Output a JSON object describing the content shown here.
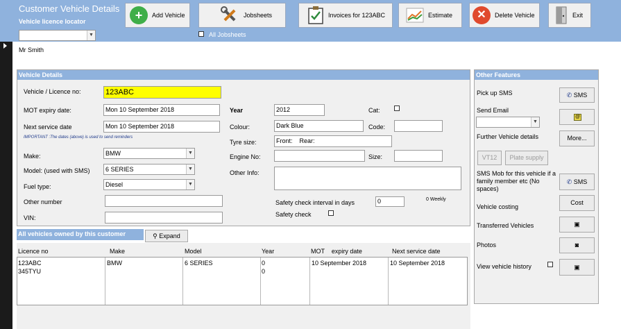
{
  "header": {
    "title": "Customer Vehicle Details",
    "locator_label": "Vehicle licence locator",
    "locator_value": "",
    "customer_name": "Mr Smith"
  },
  "toolbar": {
    "add_vehicle": "Add Vehicle",
    "jobsheets": "Jobsheets",
    "invoices": "Invoices for 123ABC",
    "estimate": "Estimate",
    "delete_vehicle": "Delete Vehicle",
    "exit": "Exit",
    "all_jobsheets": "All Jobsheets"
  },
  "vehicle_details": {
    "title": "Vehicle Details",
    "licence_label": "Vehicle  / Licence no:",
    "licence_value": "123ABC",
    "mot_label": "MOT   expiry date:",
    "mot_value": "Mon 10 September 2018",
    "next_service_label": "Next service date",
    "next_service_value": "Mon 10 September 2018",
    "important_note": "IMPORTANT :The dates (above) is used to send reminders",
    "make_label": "Make:",
    "make_value": "BMW",
    "model_label": "Model: (used with SMS)",
    "model_value": "6 SERIES",
    "fuel_label": "Fuel type:",
    "fuel_value": "Diesel",
    "other_number_label": "Other number",
    "other_number_value": "",
    "vin_label": "VIN:",
    "vin_value": "",
    "year_label": "Year",
    "year_value": "2012",
    "cat_label": "Cat:",
    "colour_label": "Colour:",
    "colour_value": "Dark Blue",
    "code_label": "Code:",
    "code_value": "",
    "tyre_label": "Tyre size:",
    "tyre_value": "Front:    Rear:",
    "engine_label": "Engine No:",
    "engine_value": "",
    "size_label": "Size:",
    "size_value": "",
    "other_info_label": "Other Info:",
    "other_info_value": "",
    "safety_interval_label": "Safety check interval in days",
    "safety_interval_value": "0",
    "weekly_label": "0  Weekly",
    "safety_check_label": "Safety check"
  },
  "owned": {
    "title": "All vehicles owned by this customer",
    "expand": "Expand",
    "columns": [
      "Licence no",
      "Make",
      "Model",
      "Year",
      "MOT    expiry date",
      "Next service date"
    ],
    "rows": [
      {
        "licence": "123ABC",
        "make": "BMW",
        "model": "6 SERIES",
        "year": "0",
        "mot": "10 September 2018",
        "service": "10 September 2018"
      },
      {
        "licence": "345TYU",
        "make": "",
        "model": "",
        "year": "0",
        "mot": "",
        "service": ""
      }
    ]
  },
  "features": {
    "title": "Other Features",
    "pickup_sms_label": "Pick up SMS",
    "sms_button": "SMS",
    "send_email_label": "Send Email",
    "further_details_label": "Further Vehicle details",
    "more_button": "More...",
    "vt12_button": "VT12",
    "plate_supply_button": "Plate supply",
    "sms_mob_label": "SMS Mob  for this vehicle if a family member etc (No spaces)",
    "sms_mob_button": "SMS",
    "costing_label": "Vehicle costing",
    "cost_button": "Cost",
    "transferred_label": "Transferred Vehicles",
    "photos_label": "Photos",
    "history_label": "View vehicle history"
  },
  "colors": {
    "header_bg": "#8fb2dd",
    "licence_highlight": "#ffff00",
    "panel_bg": "#f0f0f0",
    "left_bar": "#1b1b1b"
  }
}
